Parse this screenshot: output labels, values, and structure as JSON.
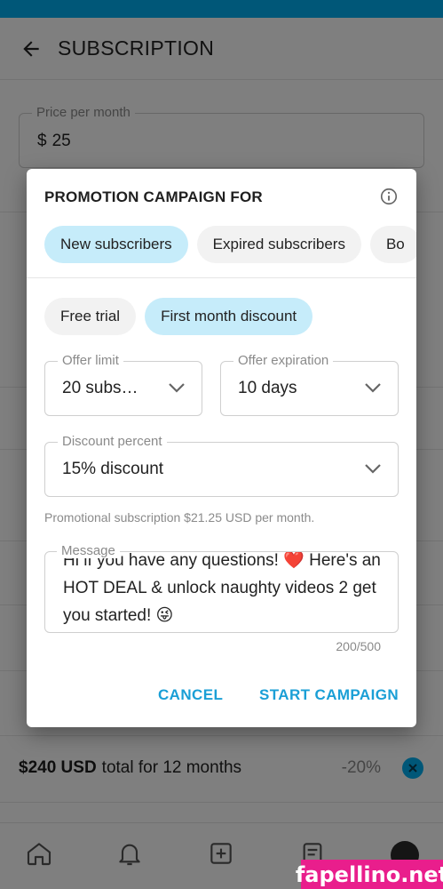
{
  "header": {
    "title": "SUBSCRIPTION",
    "back_icon": "arrow-left-icon"
  },
  "price_field": {
    "label": "Price per month",
    "currency": "$",
    "value": "25"
  },
  "bundles": [
    {
      "price": "$240 USD",
      "desc": "total for 12 months",
      "discount": "-20%"
    }
  ],
  "dialog": {
    "title": "PROMOTION CAMPAIGN FOR",
    "info_icon": "info-icon",
    "audience_chips": [
      {
        "label": "New subscribers",
        "active": true
      },
      {
        "label": "Expired subscribers",
        "active": false
      },
      {
        "label": "Bo",
        "active": false
      }
    ],
    "type_chips": [
      {
        "label": "Free trial",
        "active": false
      },
      {
        "label": "First month discount",
        "active": true
      }
    ],
    "offer_limit": {
      "label": "Offer limit",
      "value": "20 subs…"
    },
    "offer_expiration": {
      "label": "Offer expiration",
      "value": "10 days"
    },
    "discount_percent": {
      "label": "Discount percent",
      "value": "15% discount"
    },
    "promo_note": "Promotional subscription $21.25 USD per month.",
    "message": {
      "label": "Message",
      "text": "Hi if you have any questions! ❤️ Here's an HOT DEAL & unlock naughty videos 2 get you started! 😜",
      "counter": "200/500"
    },
    "cancel_label": "CANCEL",
    "start_label": "START CAMPAIGN"
  },
  "watermark": "fapellino.net",
  "colors": {
    "accent": "#00aff0",
    "chip_active": "#c6ecfa",
    "button_text": "#1a9fd6"
  }
}
